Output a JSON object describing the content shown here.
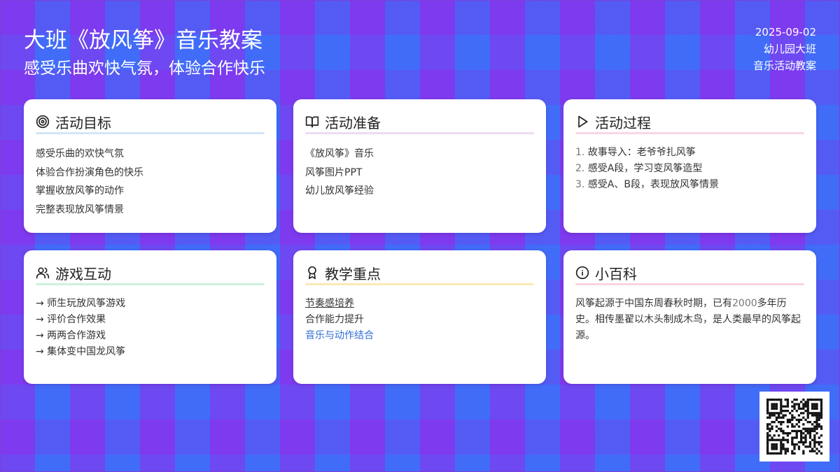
{
  "header": {
    "title": "大班《放风筝》音乐教案",
    "subtitle": "感受乐曲欢快气氛，体验合作快乐",
    "date": "2025-09-02",
    "class": "幼儿园大班",
    "doc_type": "音乐活动教案"
  },
  "cards": {
    "goals": {
      "title": "活动目标",
      "icon": "target-icon",
      "rule_color": "#d3e6f7",
      "items": [
        "感受乐曲的欢快气氛",
        "体验合作扮演角色的快乐",
        "掌握收放风筝的动作",
        "完整表现放风筝情景"
      ]
    },
    "prep": {
      "title": "活动准备",
      "icon": "book-open-icon",
      "rule_color": "#ecdcf5",
      "items": [
        "《放风筝》音乐",
        "风筝图片PPT",
        "幼儿放风筝经验"
      ]
    },
    "process": {
      "title": "活动过程",
      "icon": "play-icon",
      "rule_color": "#f8d7e6",
      "steps": [
        {
          "num": "1.",
          "text": "故事导入：老爷爷扎风筝"
        },
        {
          "num": "2.",
          "text": "感受A段，学习变风筝造型"
        },
        {
          "num": "3.",
          "text": "感受A、B段，表现放风筝情景"
        }
      ]
    },
    "games": {
      "title": "游戏互动",
      "icon": "users-icon",
      "rule_color": "#cdf1dc",
      "items": [
        "→ 师生玩放风筝游戏",
        "→ 评价合作效果",
        "→ 两两合作游戏",
        "→ 集体变中国龙风筝"
      ]
    },
    "keypoints": {
      "title": "教学重点",
      "icon": "award-icon",
      "rule_color": "#fbeab5",
      "items": [
        "节奏感培养",
        "合作能力提升",
        "音乐与动作结合"
      ],
      "link_color": "#2f6fd6"
    },
    "trivia": {
      "title": "小百科",
      "icon": "info-icon",
      "rule_color": "#f9d4dd",
      "text_before": "风筝起源于中国东周春秋时期，已有",
      "text_number": "2000",
      "text_after": "多年历史。相传墨翟以木头制成木鸟，是人类最早的风筝起源。"
    }
  },
  "qr": {
    "icon": "qr-code-icon"
  }
}
